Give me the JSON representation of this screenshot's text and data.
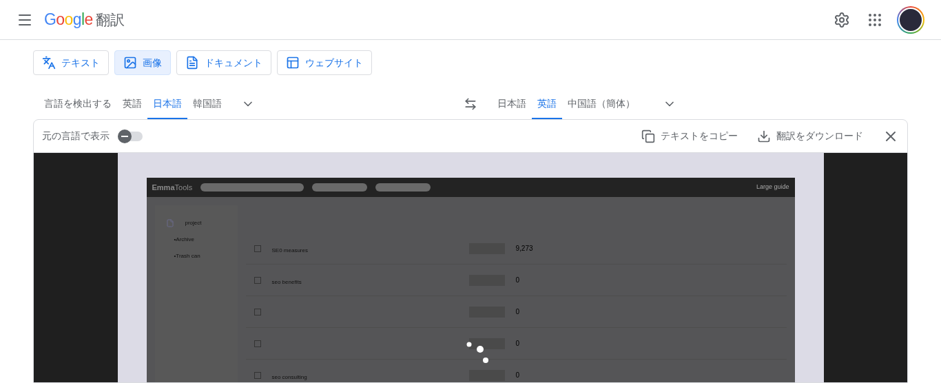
{
  "header": {
    "logo": "Google",
    "title": "翻訳"
  },
  "modes": [
    {
      "kind": "text",
      "label": "テキスト",
      "selected": false
    },
    {
      "kind": "image",
      "label": "画像",
      "selected": true
    },
    {
      "kind": "document",
      "label": "ドキュメント",
      "selected": false
    },
    {
      "kind": "website",
      "label": "ウェブサイト",
      "selected": false
    }
  ],
  "source_languages": [
    {
      "label": "言語を検出する",
      "selected": false
    },
    {
      "label": "英語",
      "selected": false
    },
    {
      "label": "日本語",
      "selected": true
    },
    {
      "label": "韓国語",
      "selected": false
    }
  ],
  "target_languages": [
    {
      "label": "日本語",
      "selected": false
    },
    {
      "label": "英語",
      "selected": true
    },
    {
      "label": "中国語（簡体）",
      "selected": false
    }
  ],
  "toolbar": {
    "show_original": {
      "label": "元の言語で表示",
      "on": false
    },
    "copy": "テキストをコピー",
    "download": "翻訳をダウンロード"
  },
  "image": {
    "loading": true,
    "app_name_bold": "Emma",
    "app_name_rest": "Tools",
    "guide": "Large guide",
    "sidebar": [
      {
        "label": "project",
        "kind": "folder"
      },
      {
        "label": "•Archive",
        "kind": "sub"
      },
      {
        "label": "•Trash can",
        "kind": "sub"
      }
    ],
    "rows": [
      {
        "name": "SE0 measures",
        "count": "9,273",
        "checked": false
      },
      {
        "name": "seo benefits",
        "count": "0",
        "checked": false
      },
      {
        "count": "0",
        "checked": false
      },
      {
        "count": "0",
        "checked": false
      },
      {
        "name": "seo consulting",
        "count": "0",
        "checked": false
      }
    ]
  }
}
